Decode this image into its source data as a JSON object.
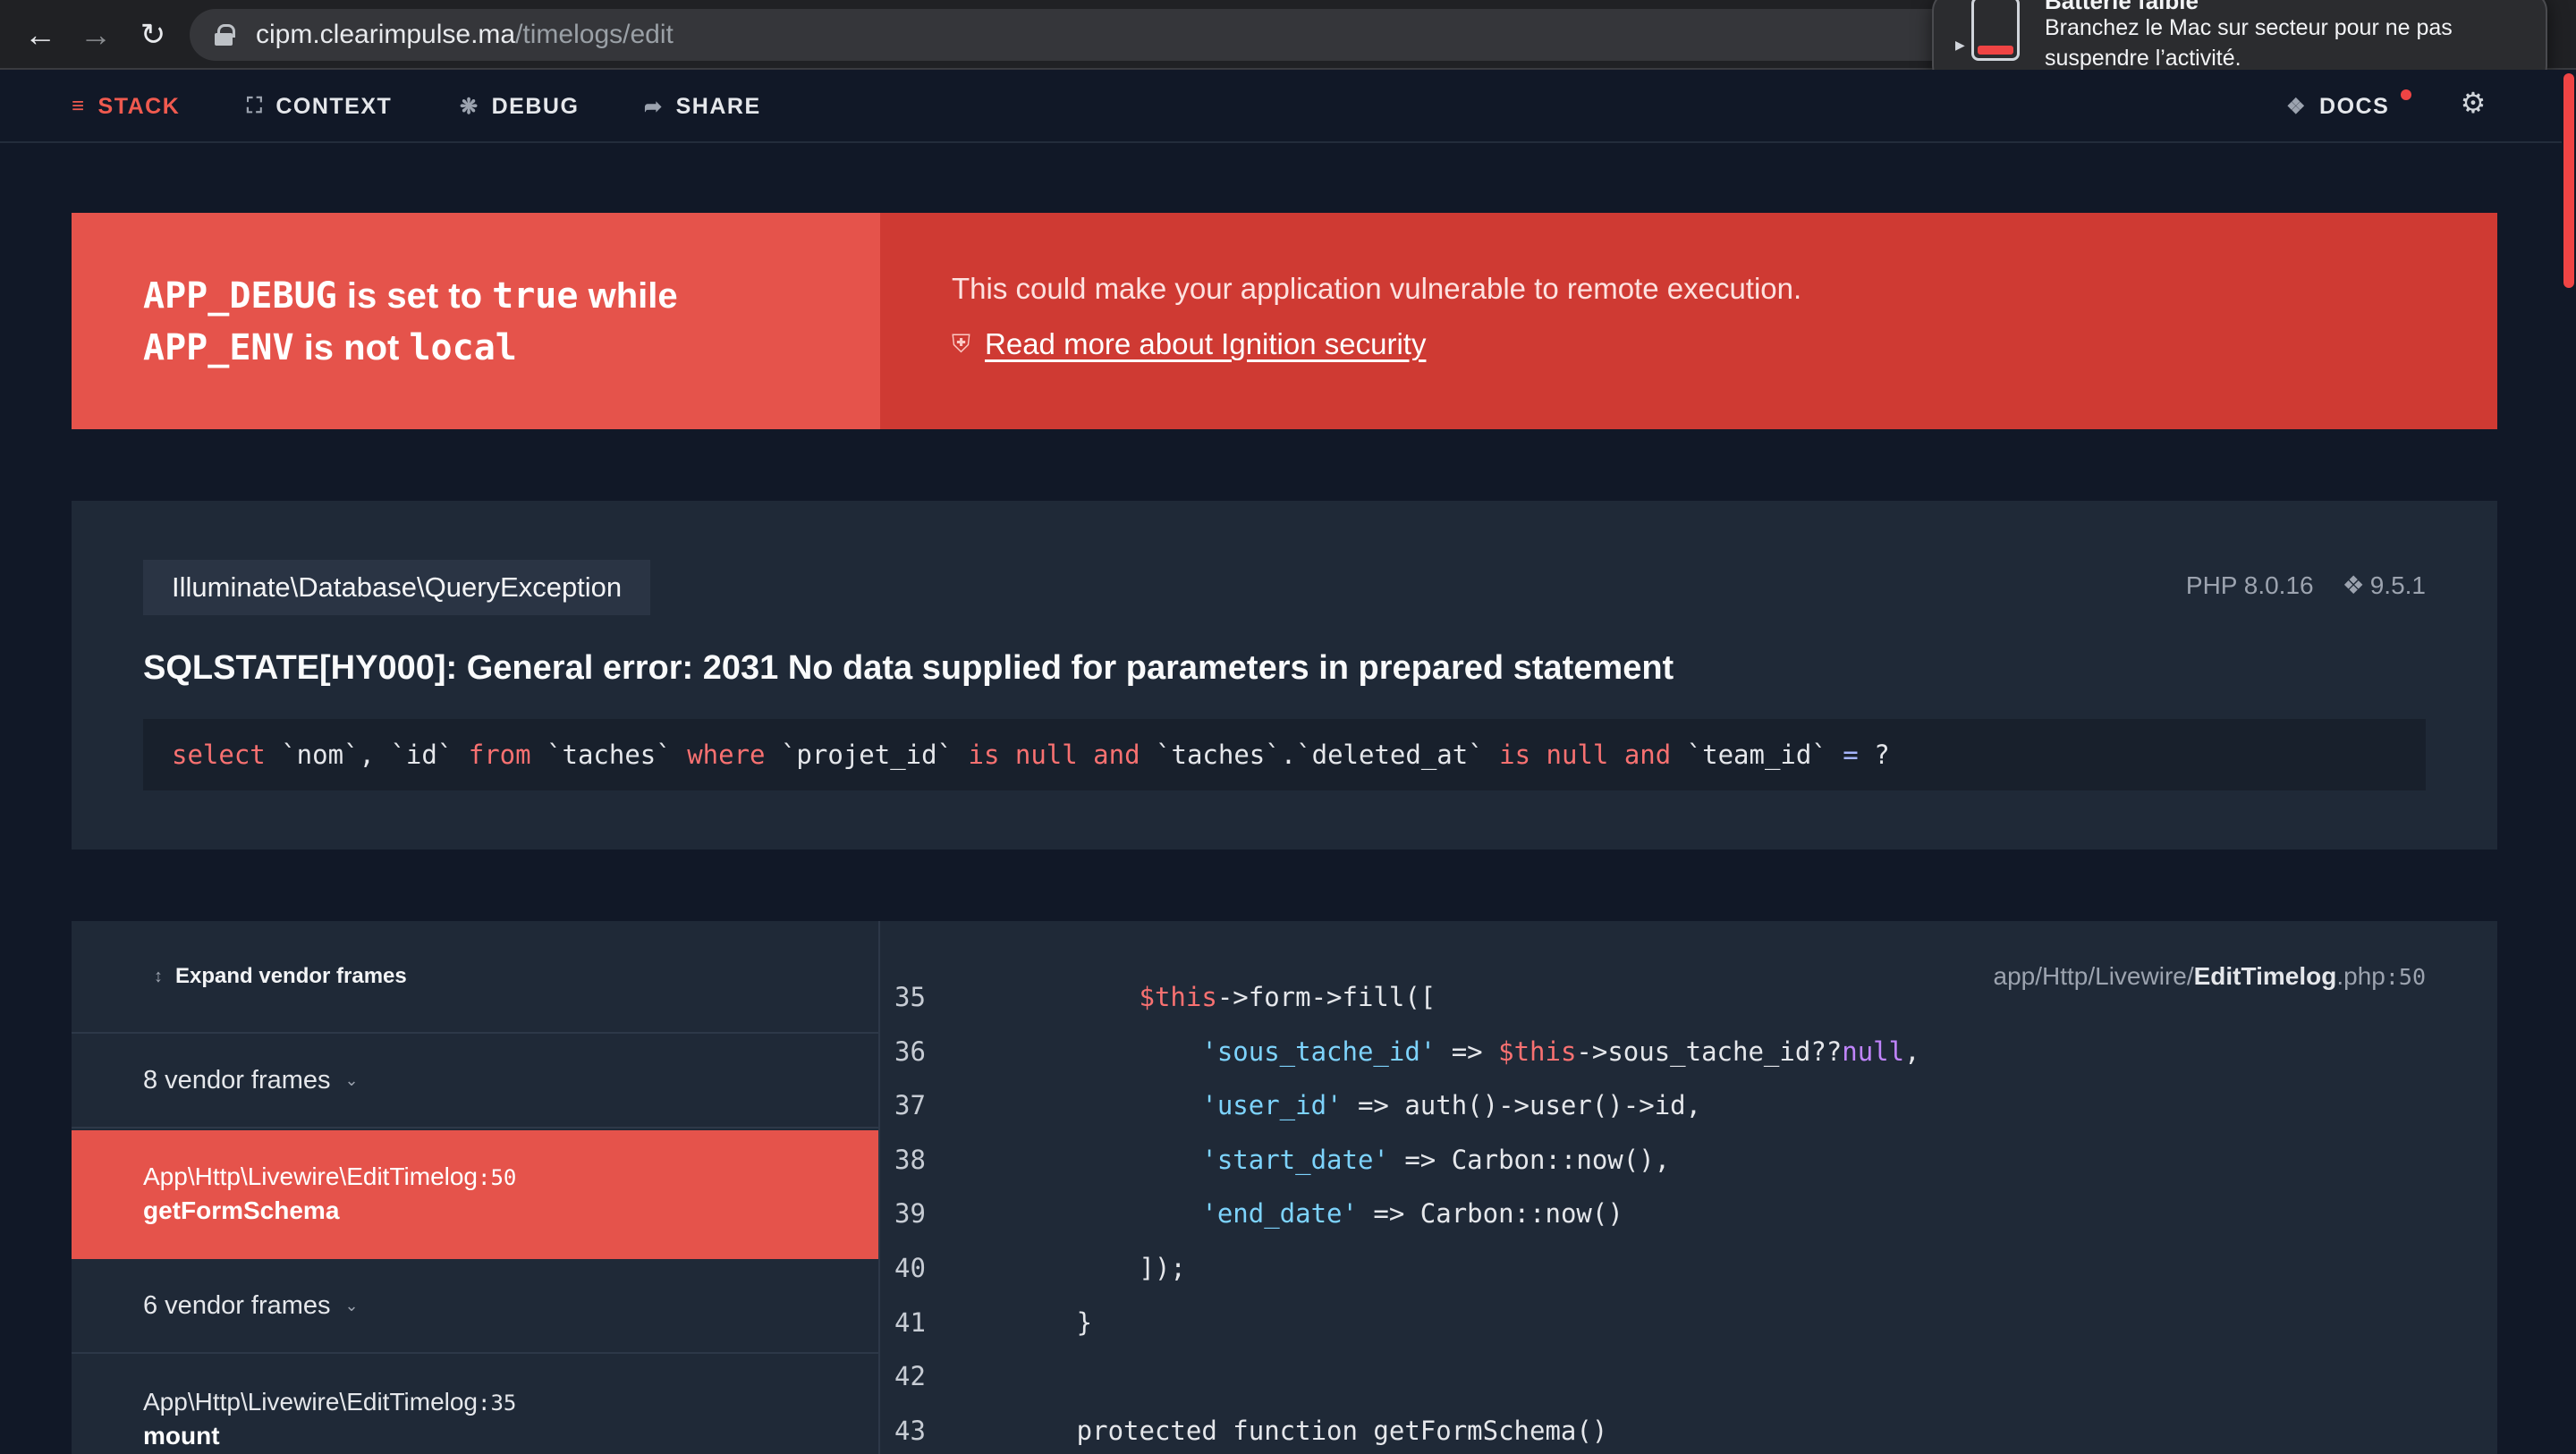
{
  "browser": {
    "url_host": "cipm.clearimpulse.ma",
    "url_path": "/timelogs/edit"
  },
  "notification": {
    "title": "Batterie faible",
    "body": "Branchez le Mac sur secteur pour ne pas suspendre l’activité."
  },
  "nav": {
    "stack": "STACK",
    "context": "CONTEXT",
    "debug": "DEBUG",
    "share": "SHARE",
    "docs": "DOCS"
  },
  "security": {
    "line1_code1": "APP_DEBUG",
    "line1_text1": " is set to ",
    "line1_code2": "true",
    "line1_text2": " while",
    "line2_code1": "APP_ENV",
    "line2_text1": " is not ",
    "line2_code2": "local",
    "message": "This could make your application vulnerable to remote execution.",
    "link": "Read more about Ignition security"
  },
  "exception": {
    "class": "Illuminate\\Database\\QueryException",
    "php_version": "PHP 8.0.16",
    "laravel_version": "9.5.1",
    "message": "SQLSTATE[HY000]: General error: 2031 No data supplied for parameters in prepared statement",
    "sql_tokens": [
      {
        "t": "select",
        "k": "kw"
      },
      {
        "t": " `nom`, `id` ",
        "k": ""
      },
      {
        "t": "from",
        "k": "kw"
      },
      {
        "t": " `taches` ",
        "k": ""
      },
      {
        "t": "where",
        "k": "kw"
      },
      {
        "t": " `projet_id` ",
        "k": ""
      },
      {
        "t": "is null and",
        "k": "kw"
      },
      {
        "t": " `taches`.`deleted_at` ",
        "k": ""
      },
      {
        "t": "is null and",
        "k": "kw"
      },
      {
        "t": " `team_id` ",
        "k": ""
      },
      {
        "t": "=",
        "k": "op"
      },
      {
        "t": " ?",
        "k": ""
      }
    ]
  },
  "stack": {
    "expand_label": "Expand vendor frames",
    "vendor_frames_1": "8 vendor frames",
    "vendor_frames_2": "6 vendor frames",
    "frames": [
      {
        "class": "App\\Http\\Livewire\\EditTimelog",
        "line": ":50",
        "method": "getFormSchema"
      },
      {
        "class": "App\\Http\\Livewire\\EditTimelog",
        "line": ":35",
        "method": "mount"
      }
    ],
    "file": {
      "dir": "app/Http/Livewire/",
      "name": "EditTimelog",
      "ext": ".php",
      "line": ":50"
    },
    "code_lines": [
      {
        "n": "35",
        "tokens": [
          {
            "t": "            ",
            "k": ""
          },
          {
            "t": "$this",
            "k": "c-var"
          },
          {
            "t": "->form->fill([",
            "k": ""
          }
        ]
      },
      {
        "n": "36",
        "tokens": [
          {
            "t": "                ",
            "k": ""
          },
          {
            "t": "'sous_tache_id'",
            "k": "c-str"
          },
          {
            "t": " => ",
            "k": ""
          },
          {
            "t": "$this",
            "k": "c-var"
          },
          {
            "t": "->sous_tache_id??",
            "k": ""
          },
          {
            "t": "null",
            "k": "c-null"
          },
          {
            "t": ",",
            "k": ""
          }
        ]
      },
      {
        "n": "37",
        "tokens": [
          {
            "t": "                ",
            "k": ""
          },
          {
            "t": "'user_id'",
            "k": "c-str"
          },
          {
            "t": " => auth()->user()->id,",
            "k": ""
          }
        ]
      },
      {
        "n": "38",
        "tokens": [
          {
            "t": "                ",
            "k": ""
          },
          {
            "t": "'start_date'",
            "k": "c-str"
          },
          {
            "t": " => Carbon::now(),",
            "k": ""
          }
        ]
      },
      {
        "n": "39",
        "tokens": [
          {
            "t": "                ",
            "k": ""
          },
          {
            "t": "'end_date'",
            "k": "c-str"
          },
          {
            "t": " => Carbon::now()",
            "k": ""
          }
        ]
      },
      {
        "n": "40",
        "tokens": [
          {
            "t": "            ]);",
            "k": ""
          }
        ]
      },
      {
        "n": "41",
        "tokens": [
          {
            "t": "        }",
            "k": ""
          }
        ]
      },
      {
        "n": "42",
        "tokens": [
          {
            "t": "",
            "k": ""
          }
        ]
      },
      {
        "n": "43",
        "tokens": [
          {
            "t": "        protected function getFormSchema()",
            "k": ""
          }
        ]
      }
    ]
  },
  "colors": {
    "accent": "#e5534b",
    "accent_dark": "#cf3a33",
    "background": "#111827",
    "panel": "#1f2937"
  },
  "icons": [
    "back-arrow-icon",
    "forward-arrow-icon",
    "reload-icon",
    "lock-icon",
    "battery-icon",
    "stack-icon",
    "context-icon",
    "debug-icon",
    "share-icon",
    "laravel-icon",
    "gear-icon",
    "shield-icon",
    "chevron-down-icon",
    "updown-icon"
  ]
}
